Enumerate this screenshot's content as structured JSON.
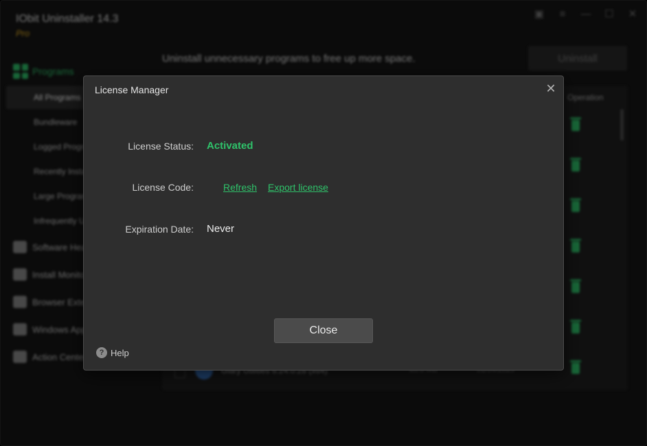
{
  "app": {
    "title": "IObit Uninstaller 14.3",
    "edition": "Pro",
    "subtitle": "Uninstall unnecessary programs to free up more space.",
    "uninstall_label": "Uninstall",
    "accent_color": "#2fc26a"
  },
  "sidebar": {
    "section_label": "Programs",
    "sub_items": [
      {
        "label": "All Programs",
        "active": true
      },
      {
        "label": "Bundleware"
      },
      {
        "label": "Logged Programs"
      },
      {
        "label": "Recently Installed"
      },
      {
        "label": "Large Programs"
      },
      {
        "label": "Infrequently Used"
      }
    ],
    "items": [
      {
        "label": "Software Health",
        "icon": "software-health-icon"
      },
      {
        "label": "Install Monitor",
        "icon": "install-monitor-icon"
      },
      {
        "label": "Browser Extensions",
        "icon": "puzzle-icon"
      },
      {
        "label": "Windows Apps",
        "icon": "windows-apps-icon"
      },
      {
        "label": "Action Center",
        "icon": "action-center-icon"
      }
    ]
  },
  "program_list": {
    "operation_header": "Operation",
    "rows": [
      {
        "name": "",
        "size": "",
        "date": ""
      },
      {
        "name": "",
        "size": "",
        "date": ""
      },
      {
        "name": "",
        "size": "",
        "date": ""
      },
      {
        "name": "",
        "size": "",
        "date": ""
      },
      {
        "name": "",
        "size": "",
        "date": ""
      },
      {
        "name": "",
        "size": "",
        "date": ""
      },
      {
        "name": "Glary Utilities 6.24.0.28 (x64)",
        "size": "83.3 MB",
        "date": "01/04/2025"
      }
    ]
  },
  "dialog": {
    "title": "License Manager",
    "status_label": "License Status:",
    "status_value": "Activated",
    "code_label": "License Code:",
    "refresh_link": "Refresh",
    "export_link": "Export license",
    "expiration_label": "Expiration Date:",
    "expiration_value": "Never",
    "close_button": "Close",
    "help_label": "Help"
  }
}
